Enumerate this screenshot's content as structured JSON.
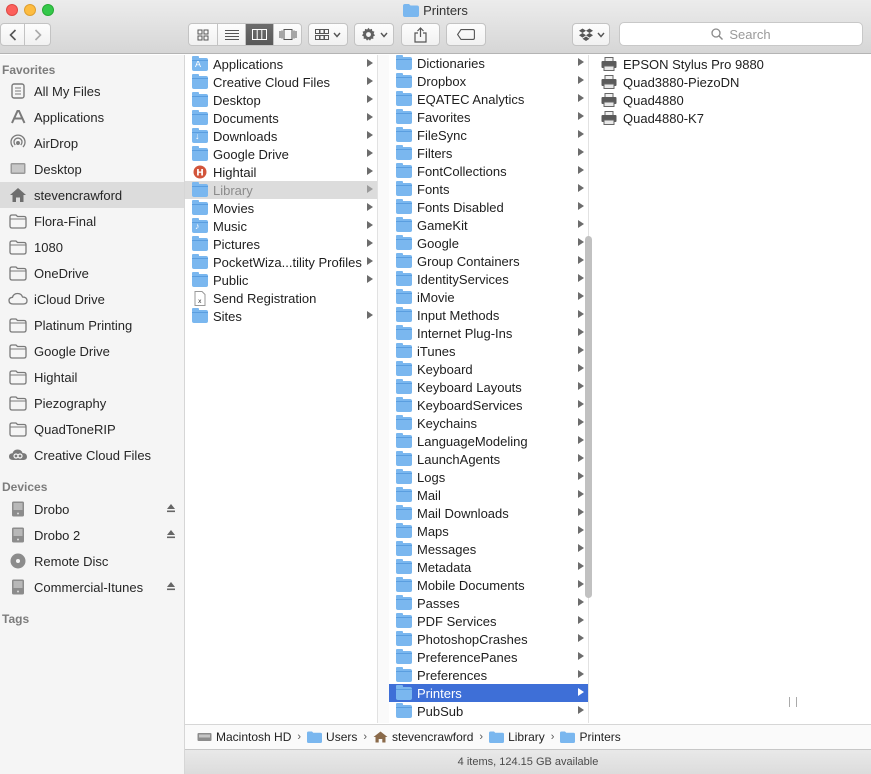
{
  "window": {
    "title": "Printers"
  },
  "search": {
    "placeholder": "Search"
  },
  "sidebar": {
    "favorites_header": "Favorites",
    "favorites": [
      {
        "label": "All My Files",
        "icon": "all-files-icon"
      },
      {
        "label": "Applications",
        "icon": "applications-icon"
      },
      {
        "label": "AirDrop",
        "icon": "airdrop-icon"
      },
      {
        "label": "Desktop",
        "icon": "desktop-icon"
      },
      {
        "label": "stevencrawford",
        "icon": "home-icon",
        "selected": true
      },
      {
        "label": "Flora-Final",
        "icon": "folder-icon"
      },
      {
        "label": "1080",
        "icon": "folder-icon"
      },
      {
        "label": "OneDrive",
        "icon": "folder-icon"
      },
      {
        "label": "iCloud Drive",
        "icon": "cloud-icon"
      },
      {
        "label": "Platinum Printing",
        "icon": "folder-icon"
      },
      {
        "label": "Google Drive",
        "icon": "folder-icon"
      },
      {
        "label": "Hightail",
        "icon": "folder-icon"
      },
      {
        "label": "Piezography",
        "icon": "folder-icon"
      },
      {
        "label": "QuadToneRIP",
        "icon": "folder-icon"
      },
      {
        "label": "Creative Cloud Files",
        "icon": "creative-cloud-icon"
      }
    ],
    "devices_header": "Devices",
    "devices": [
      {
        "label": "Drobo",
        "icon": "drive-icon",
        "eject": true
      },
      {
        "label": "Drobo 2",
        "icon": "drive-icon",
        "eject": true
      },
      {
        "label": "Remote Disc",
        "icon": "disc-icon",
        "eject": false
      },
      {
        "label": "Commercial-Itunes",
        "icon": "drive-icon",
        "eject": true
      }
    ],
    "tags_header": "Tags"
  },
  "column1": [
    {
      "label": "Applications",
      "glyph": "A"
    },
    {
      "label": "Creative Cloud Files",
      "glyph": ""
    },
    {
      "label": "Desktop",
      "glyph": ""
    },
    {
      "label": "Documents",
      "glyph": ""
    },
    {
      "label": "Downloads",
      "glyph": "↓"
    },
    {
      "label": "Google Drive",
      "glyph": ""
    },
    {
      "label": "Hightail",
      "glyph": "H",
      "kind": "hightail"
    },
    {
      "label": "Library",
      "glyph": "",
      "state": "gray"
    },
    {
      "label": "Movies",
      "glyph": ""
    },
    {
      "label": "Music",
      "glyph": "♪"
    },
    {
      "label": "Pictures",
      "glyph": ""
    },
    {
      "label": "PocketWiza...tility Profiles",
      "glyph": ""
    },
    {
      "label": "Public",
      "glyph": ""
    },
    {
      "label": "Send Registration",
      "glyph": "",
      "kind": "file",
      "noarrow": true
    },
    {
      "label": "Sites",
      "glyph": ""
    }
  ],
  "column2": [
    "Dictionaries",
    "Dropbox",
    "EQATEC Analytics",
    "Favorites",
    "FileSync",
    "Filters",
    "FontCollections",
    "Fonts",
    "Fonts Disabled",
    "GameKit",
    "Google",
    "Group Containers",
    "IdentityServices",
    "iMovie",
    "Input Methods",
    "Internet Plug-Ins",
    "iTunes",
    "Keyboard",
    "Keyboard Layouts",
    "KeyboardServices",
    "Keychains",
    "LanguageModeling",
    "LaunchAgents",
    "Logs",
    "Mail",
    "Mail Downloads",
    "Maps",
    "Messages",
    "Metadata",
    "Mobile Documents",
    "Passes",
    "PDF Services",
    "PhotoshopCrashes",
    "PreferencePanes",
    "Preferences",
    "Printers",
    "PubSub"
  ],
  "column2_selected": "Printers",
  "column3": [
    "EPSON Stylus Pro 9880",
    "Quad3880-PiezoDN",
    "Quad4880",
    "Quad4880-K7"
  ],
  "pathbar": [
    "Macintosh HD",
    "Users",
    "stevencrawford",
    "Library",
    "Printers"
  ],
  "status": "4 items, 124.15 GB available",
  "colors": {
    "selection_blue": "#3e6fd7",
    "folder_blue": "#7ab7ef"
  }
}
